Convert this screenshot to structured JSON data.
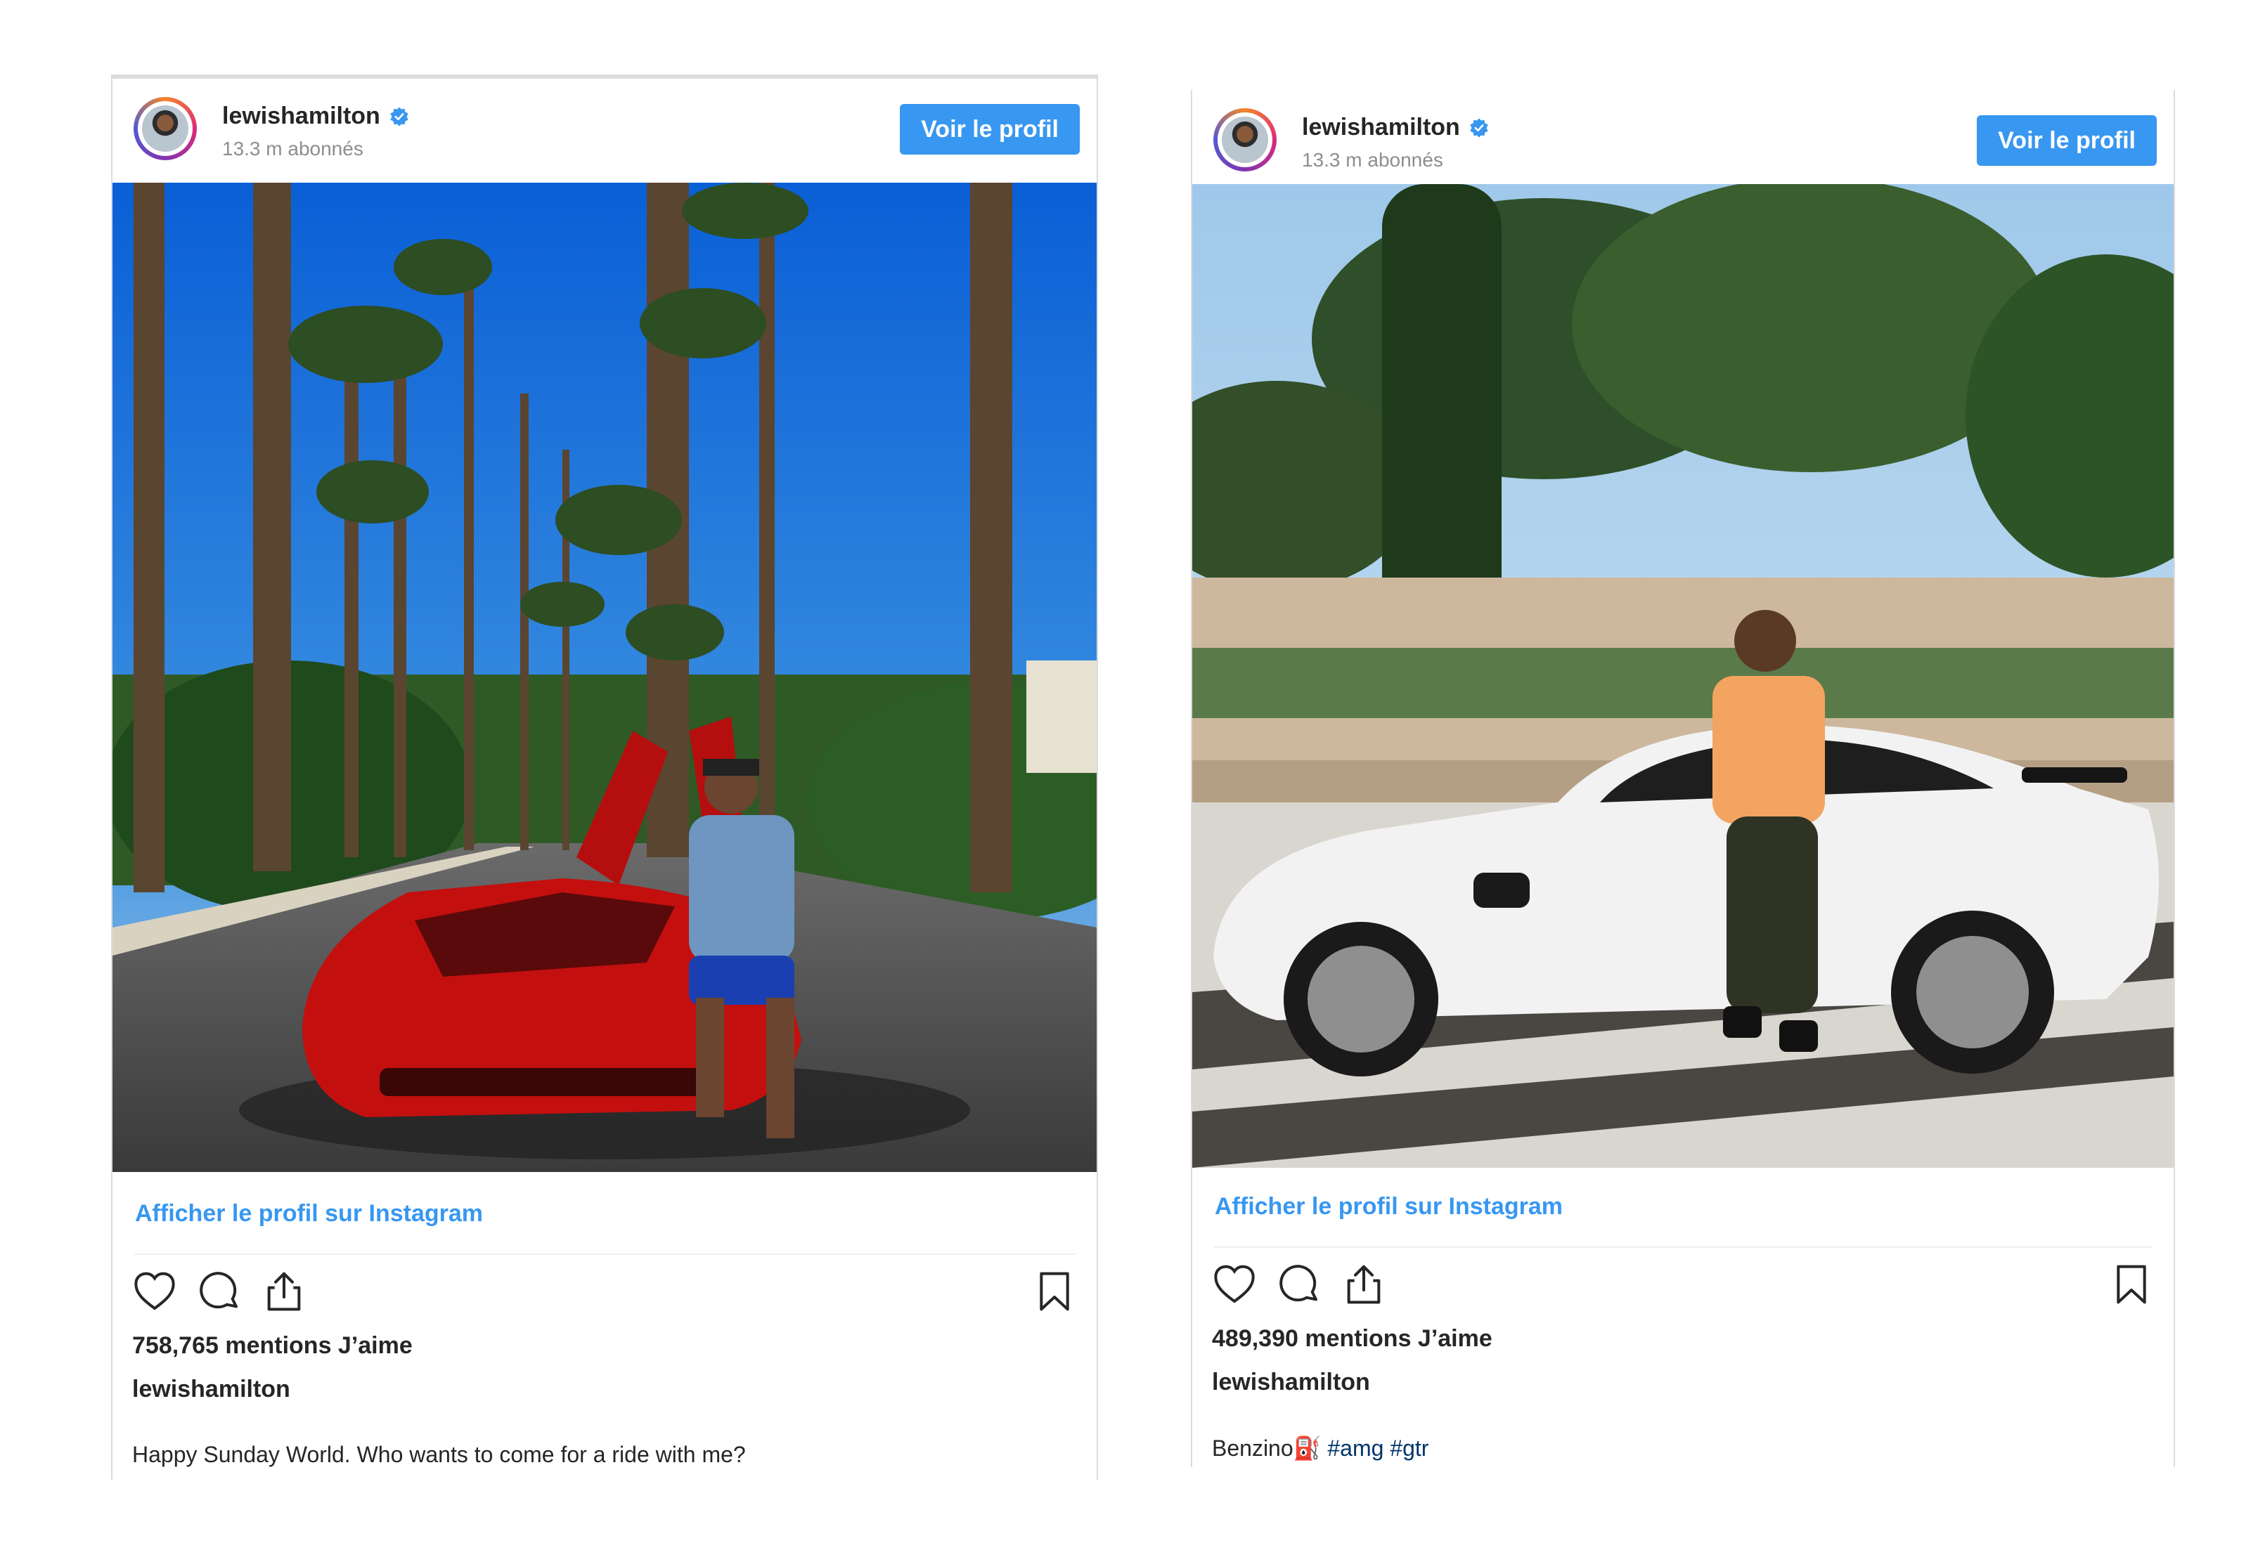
{
  "posts": [
    {
      "username": "lewishamilton",
      "verified_icon": "verified-badge-icon",
      "followers": "13.3 m abonnés",
      "view_profile_button": "Voir le profil",
      "view_on_instagram_link": "Afficher le profil sur Instagram",
      "likes": "758,765 mentions J’aime",
      "caption_username": "lewishamilton",
      "caption_text": "Happy Sunday World. Who wants to come for a ride with me?",
      "photo_icon": "photo-red-ferrari-palm-street"
    },
    {
      "username": "lewishamilton",
      "verified_icon": "verified-badge-icon",
      "followers": "13.3 m abonnés",
      "view_profile_button": "Voir le profil",
      "view_on_instagram_link": "Afficher le profil sur Instagram",
      "likes": "489,390 mentions J’aime",
      "caption_username": "lewishamilton",
      "caption_text": "Benzino⛽",
      "hashtags": [
        "#amg",
        "#gtr"
      ],
      "photo_icon": "photo-white-mercedes-amg-gtr"
    }
  ],
  "icons": [
    "heart-icon",
    "comment-icon",
    "share-icon",
    "bookmark-icon"
  ],
  "colors": {
    "link_blue": "#3897f0",
    "text": "#262626",
    "muted": "#8e8e8e",
    "hashtag": "#003569"
  }
}
